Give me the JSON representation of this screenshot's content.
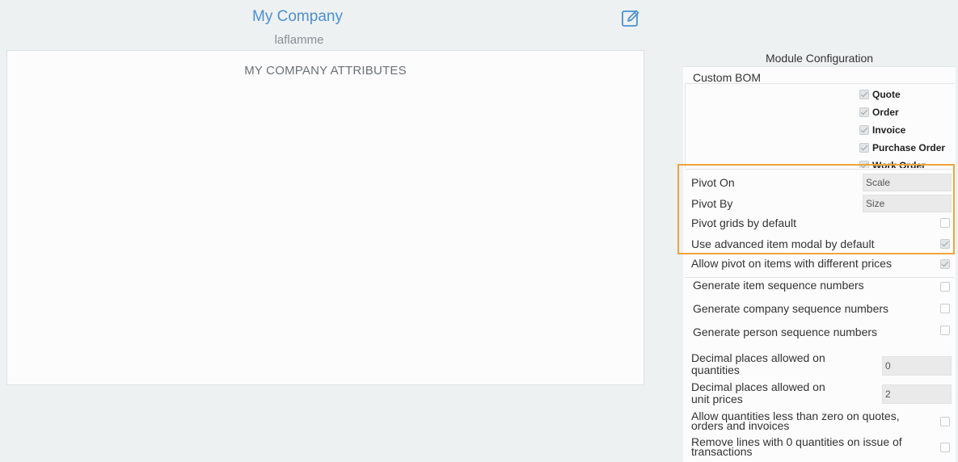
{
  "header": {
    "title": "My Company",
    "subtitle": "laflamme"
  },
  "attributes_panel": {
    "title": "MY COMPANY ATTRIBUTES"
  },
  "module_config": {
    "title": "Module Configuration",
    "custom_bom": {
      "label": "Custom BOM",
      "items": [
        {
          "label": "Quote",
          "checked": true
        },
        {
          "label": "Order",
          "checked": true
        },
        {
          "label": "Invoice",
          "checked": true
        },
        {
          "label": "Purchase Order",
          "checked": true
        },
        {
          "label": "Work Order",
          "checked": true
        }
      ]
    },
    "pivot_on": {
      "label": "Pivot On",
      "value": "Scale"
    },
    "pivot_by": {
      "label": "Pivot By",
      "value": "Size"
    },
    "pivot_grids": {
      "label": "Pivot grids by default",
      "checked": false
    },
    "advanced_modal": {
      "label": "Use advanced item modal by default",
      "checked": true
    },
    "pivot_diff_prices": {
      "label": "Allow pivot on items with different prices",
      "checked": true
    },
    "gen_item_seq": {
      "label": "Generate item sequence numbers",
      "checked": false
    },
    "gen_company_seq": {
      "label": "Generate company sequence numbers",
      "checked": false
    },
    "gen_person_seq": {
      "label": "Generate person sequence numbers",
      "checked": false
    },
    "decimal_qty": {
      "label_line1": "Decimal places allowed on",
      "label_line2": "quantities",
      "value": "0"
    },
    "decimal_price": {
      "label_line1": "Decimal places allowed on",
      "label_line2": "unit prices",
      "value": "2"
    },
    "allow_negative": {
      "label_line1": "Allow quantities less than zero on quotes,",
      "label_line2": "orders and invoices",
      "checked": false
    },
    "remove_zero": {
      "label_line1": "Remove lines with 0 quantities on issue of",
      "label_line2": "transactions",
      "checked": false
    }
  },
  "colors": {
    "title_blue": "#4a90d2",
    "highlight_orange": "#f0a43a",
    "background": "#eef1f2"
  },
  "icons": {
    "edit": "edit-pencil-icon"
  }
}
